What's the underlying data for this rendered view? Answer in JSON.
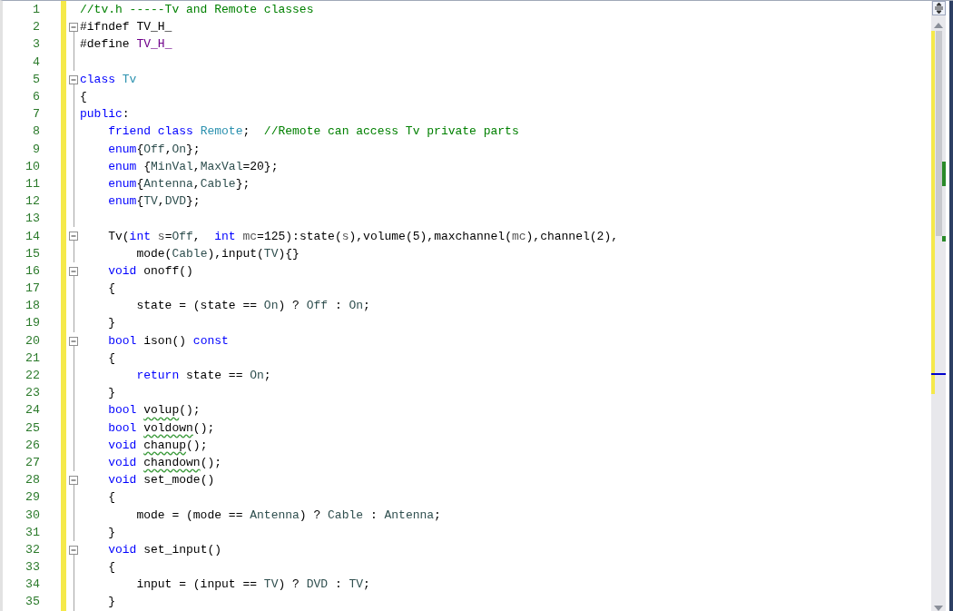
{
  "editor": {
    "lines": [
      {
        "number": "1",
        "kind": "plain",
        "changed": true,
        "tokens": [
          {
            "kind": "comment",
            "t": "//tv.h -----Tv and Remote classes"
          }
        ]
      },
      {
        "number": "2",
        "kind": "fold",
        "changed": true,
        "tokens": [
          {
            "kind": "plain",
            "t": "#ifndef TV_H_"
          }
        ]
      },
      {
        "number": "3",
        "kind": "inner",
        "changed": true,
        "tokens": [
          {
            "kind": "plain",
            "t": "#define "
          },
          {
            "kind": "macro",
            "t": "TV_H_"
          }
        ]
      },
      {
        "number": "4",
        "kind": "inner",
        "changed": true
      },
      {
        "number": "5",
        "kind": "fold",
        "changed": true,
        "tokens": [
          {
            "kind": "kw",
            "t": "class"
          },
          {
            "kind": "type",
            "t": " Tv"
          }
        ]
      },
      {
        "number": "6",
        "kind": "inner",
        "changed": true,
        "tokens": [
          {
            "kind": "plain",
            "t": "{"
          }
        ]
      },
      {
        "number": "7",
        "kind": "inner",
        "changed": true,
        "tokens": [
          {
            "kind": "kw",
            "t": "public"
          },
          {
            "kind": "plain",
            "t": ":"
          }
        ]
      },
      {
        "number": "8",
        "kind": "inner",
        "changed": true,
        "tokens": [
          {
            "kind": "kw",
            "t": "    friend class"
          },
          {
            "kind": "type",
            "t": " Remote"
          },
          {
            "kind": "plain",
            "t": ";  "
          },
          {
            "kind": "comment",
            "t": "//Remote can access Tv private parts"
          }
        ]
      },
      {
        "number": "9",
        "kind": "inner",
        "changed": true,
        "tokens": [
          {
            "kind": "kw",
            "t": "    enum"
          },
          {
            "kind": "plain",
            "t": "{"
          },
          {
            "kind": "enum",
            "t": "Off"
          },
          {
            "kind": "plain",
            "t": ","
          },
          {
            "kind": "enum",
            "t": "On"
          },
          {
            "kind": "plain",
            "t": "};"
          }
        ]
      },
      {
        "number": "10",
        "kind": "inner",
        "changed": true,
        "tokens": [
          {
            "kind": "kw",
            "t": "    enum"
          },
          {
            "kind": "plain",
            "t": " {"
          },
          {
            "kind": "enum",
            "t": "MinVal"
          },
          {
            "kind": "plain",
            "t": ","
          },
          {
            "kind": "enum",
            "t": "MaxVal"
          },
          {
            "kind": "plain",
            "t": "=20};"
          }
        ]
      },
      {
        "number": "11",
        "kind": "inner",
        "changed": true,
        "tokens": [
          {
            "kind": "kw",
            "t": "    enum"
          },
          {
            "kind": "plain",
            "t": "{"
          },
          {
            "kind": "enum",
            "t": "Antenna"
          },
          {
            "kind": "plain",
            "t": ","
          },
          {
            "kind": "enum",
            "t": "Cable"
          },
          {
            "kind": "plain",
            "t": "};"
          }
        ]
      },
      {
        "number": "12",
        "kind": "inner",
        "changed": true,
        "tokens": [
          {
            "kind": "kw",
            "t": "    enum"
          },
          {
            "kind": "plain",
            "t": "{"
          },
          {
            "kind": "enum",
            "t": "TV"
          },
          {
            "kind": "plain",
            "t": ","
          },
          {
            "kind": "enum",
            "t": "DVD"
          },
          {
            "kind": "plain",
            "t": "};"
          }
        ]
      },
      {
        "number": "13",
        "kind": "inner",
        "changed": true
      },
      {
        "number": "14",
        "kind": "fold",
        "changed": true,
        "tokens": [
          {
            "kind": "plain",
            "t": "    Tv("
          },
          {
            "kind": "kw",
            "t": "int"
          },
          {
            "kind": "param",
            "t": " s"
          },
          {
            "kind": "plain",
            "t": "="
          },
          {
            "kind": "enum",
            "t": "Off"
          },
          {
            "kind": "plain",
            "t": ","
          },
          {
            "kind": "kw",
            "t": "  int"
          },
          {
            "kind": "param",
            "t": " mc"
          },
          {
            "kind": "plain",
            "t": "=125):state("
          },
          {
            "kind": "param",
            "t": "s"
          },
          {
            "kind": "plain",
            "t": "),volume(5),maxchannel("
          },
          {
            "kind": "param",
            "t": "mc"
          },
          {
            "kind": "plain",
            "t": "),channel(2),"
          }
        ]
      },
      {
        "number": "15",
        "kind": "inner",
        "changed": true,
        "tokens": [
          {
            "kind": "plain",
            "t": "        mode("
          },
          {
            "kind": "enum",
            "t": "Cable"
          },
          {
            "kind": "plain",
            "t": "),input("
          },
          {
            "kind": "enum",
            "t": "TV"
          },
          {
            "kind": "plain",
            "t": "){}"
          }
        ]
      },
      {
        "number": "16",
        "kind": "fold",
        "changed": true,
        "tokens": [
          {
            "kind": "kw",
            "t": "    void"
          },
          {
            "kind": "plain",
            "t": " onoff()"
          }
        ]
      },
      {
        "number": "17",
        "kind": "inner",
        "changed": true,
        "tokens": [
          {
            "kind": "plain",
            "t": "    {"
          }
        ]
      },
      {
        "number": "18",
        "kind": "inner",
        "changed": true,
        "tokens": [
          {
            "kind": "plain",
            "t": "        state = (state == "
          },
          {
            "kind": "enum",
            "t": "On"
          },
          {
            "kind": "plain",
            "t": ") ? "
          },
          {
            "kind": "enum",
            "t": "Off"
          },
          {
            "kind": "plain",
            "t": " : "
          },
          {
            "kind": "enum",
            "t": "On"
          },
          {
            "kind": "plain",
            "t": ";"
          }
        ]
      },
      {
        "number": "19",
        "kind": "inner",
        "changed": true,
        "tokens": [
          {
            "kind": "plain",
            "t": "    }"
          }
        ]
      },
      {
        "number": "20",
        "kind": "fold",
        "changed": true,
        "tokens": [
          {
            "kind": "kw",
            "t": "    bool"
          },
          {
            "kind": "plain",
            "t": " ison() "
          },
          {
            "kind": "kw",
            "t": "const"
          }
        ]
      },
      {
        "number": "21",
        "kind": "inner",
        "changed": true,
        "tokens": [
          {
            "kind": "plain",
            "t": "    {"
          }
        ]
      },
      {
        "number": "22",
        "kind": "inner",
        "changed": true,
        "tokens": [
          {
            "kind": "kw",
            "t": "        return"
          },
          {
            "kind": "plain",
            "t": " state == "
          },
          {
            "kind": "enum",
            "t": "On"
          },
          {
            "kind": "plain",
            "t": ";"
          }
        ]
      },
      {
        "number": "23",
        "kind": "inner",
        "changed": true,
        "tokens": [
          {
            "kind": "plain",
            "t": "    }"
          }
        ]
      },
      {
        "number": "24",
        "kind": "inner",
        "changed": true,
        "tokens": [
          {
            "kind": "kw",
            "t": "    bool "
          },
          {
            "kind": "squiggle",
            "t": "volup"
          },
          {
            "kind": "plain",
            "t": "();"
          }
        ]
      },
      {
        "number": "25",
        "kind": "inner",
        "changed": true,
        "tokens": [
          {
            "kind": "kw",
            "t": "    bool "
          },
          {
            "kind": "squiggle",
            "t": "voldown"
          },
          {
            "kind": "plain",
            "t": "();"
          }
        ]
      },
      {
        "number": "26",
        "kind": "inner",
        "changed": true,
        "tokens": [
          {
            "kind": "kw",
            "t": "    void "
          },
          {
            "kind": "squiggle",
            "t": "chanup"
          },
          {
            "kind": "plain",
            "t": "();"
          }
        ]
      },
      {
        "number": "27",
        "kind": "inner",
        "changed": true,
        "tokens": [
          {
            "kind": "kw",
            "t": "    void "
          },
          {
            "kind": "squiggle",
            "t": "chandown"
          },
          {
            "kind": "plain",
            "t": "();"
          }
        ]
      },
      {
        "number": "28",
        "kind": "fold",
        "changed": true,
        "tokens": [
          {
            "kind": "kw",
            "t": "    void"
          },
          {
            "kind": "plain",
            "t": " set_mode()"
          }
        ]
      },
      {
        "number": "29",
        "kind": "inner",
        "changed": true,
        "tokens": [
          {
            "kind": "plain",
            "t": "    {"
          }
        ]
      },
      {
        "number": "30",
        "kind": "inner",
        "changed": true,
        "tokens": [
          {
            "kind": "plain",
            "t": "        mode = (mode == "
          },
          {
            "kind": "enum",
            "t": "Antenna"
          },
          {
            "kind": "plain",
            "t": ") ? "
          },
          {
            "kind": "enum",
            "t": "Cable"
          },
          {
            "kind": "plain",
            "t": " : "
          },
          {
            "kind": "enum",
            "t": "Antenna"
          },
          {
            "kind": "plain",
            "t": ";"
          }
        ]
      },
      {
        "number": "31",
        "kind": "inner",
        "changed": true,
        "tokens": [
          {
            "kind": "plain",
            "t": "    }"
          }
        ]
      },
      {
        "number": "32",
        "kind": "fold",
        "changed": true,
        "tokens": [
          {
            "kind": "kw",
            "t": "    void"
          },
          {
            "kind": "plain",
            "t": " set_input()"
          }
        ]
      },
      {
        "number": "33",
        "kind": "inner",
        "changed": true,
        "tokens": [
          {
            "kind": "plain",
            "t": "    {"
          }
        ]
      },
      {
        "number": "34",
        "kind": "inner",
        "changed": true,
        "tokens": [
          {
            "kind": "plain",
            "t": "        input = (input == "
          },
          {
            "kind": "enum",
            "t": "TV"
          },
          {
            "kind": "plain",
            "t": ") ? "
          },
          {
            "kind": "enum",
            "t": "DVD"
          },
          {
            "kind": "plain",
            "t": " : "
          },
          {
            "kind": "enum",
            "t": "TV"
          },
          {
            "kind": "plain",
            "t": ";"
          }
        ]
      },
      {
        "number": "35",
        "kind": "inner",
        "changed": true,
        "tokens": [
          {
            "kind": "plain",
            "t": "    }"
          }
        ]
      }
    ]
  }
}
